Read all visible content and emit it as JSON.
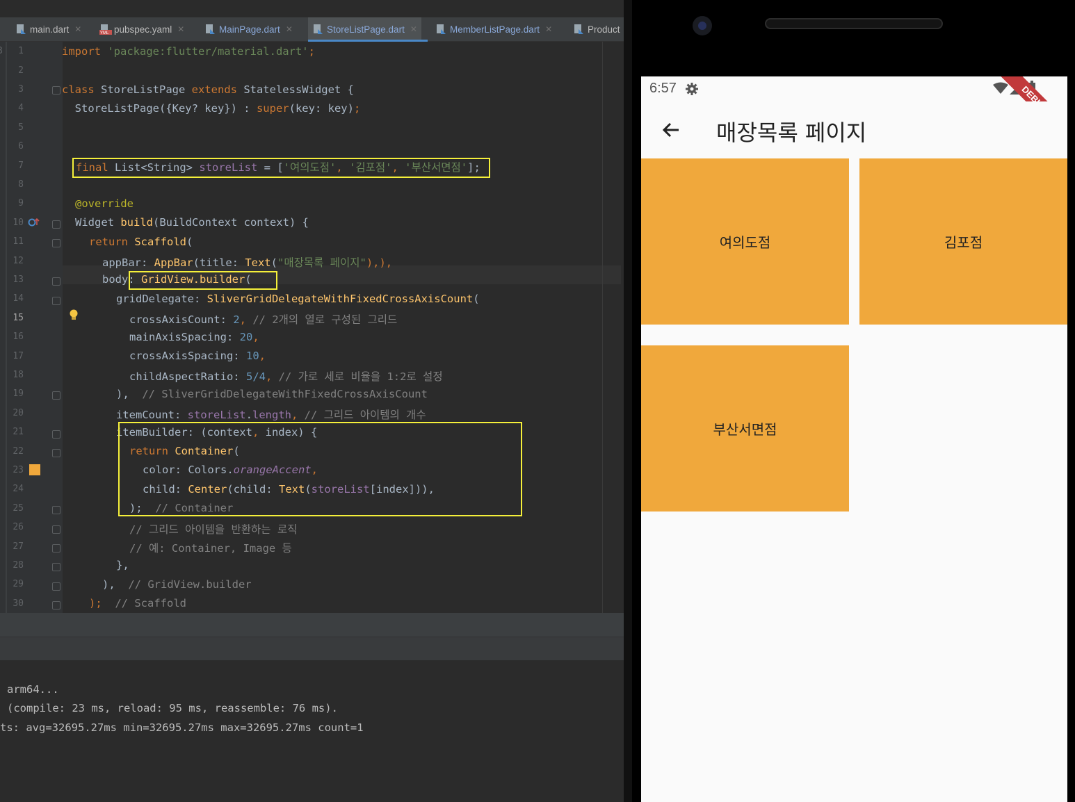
{
  "ide": {
    "tabs": [
      {
        "label": "main.dart",
        "icon": "dart-file-icon"
      },
      {
        "label": "pubspec.yaml",
        "icon": "yaml-file-icon"
      },
      {
        "label": "MainPage.dart",
        "icon": "dart-file-icon"
      },
      {
        "label": "StoreListPage.dart",
        "icon": "dart-file-icon"
      },
      {
        "label": "MemberListPage.dart",
        "icon": "dart-file-icon"
      },
      {
        "label": "Product",
        "icon": "dart-file-icon"
      }
    ],
    "gutter_marker": "3",
    "line_numbers": [
      "1",
      "2",
      "3",
      "4",
      "5",
      "6",
      "7",
      "8",
      "9",
      "10",
      "11",
      "12",
      "13",
      "14",
      "15",
      "16",
      "17",
      "18",
      "19",
      "20",
      "21",
      "22",
      "23",
      "24",
      "25",
      "26",
      "27",
      "28",
      "29",
      "30"
    ],
    "code": {
      "l1_kw": "import",
      "l1_str": " 'package:flutter/material.dart'",
      "l1_end": ";",
      "l3_kw": "class",
      "l3_a": " StoreListPage ",
      "l3_kw2": "extends",
      "l3_b": " StatelessWidget {",
      "l4_a": "  StoreListPage({Key? key}) : ",
      "l4_kw": "super",
      "l4_b": "(key: key)",
      "l4_end": ";",
      "l7_kw": "final",
      "l7_a": " List<String> ",
      "l7_var": "storeList",
      "l7_b": " = [",
      "l7_s1": "'여의도점'",
      "l7_c1": ", ",
      "l7_s2": "'김포점'",
      "l7_c2": ", ",
      "l7_s3": "'부산서면점'",
      "l7_end": "];",
      "l9": "@override",
      "l10_a": "Widget ",
      "l10_fn": "build",
      "l10_b": "(BuildContext context) {",
      "l11_kw": "return",
      "l11_fn": " Scaffold",
      "l11_b": "(",
      "l12_a": "appBar: ",
      "l12_fn": "AppBar",
      "l12_b": "(title: ",
      "l12_fn2": "Text",
      "l12_c": "(",
      "l12_str": "\"매장목록 페이지\"",
      "l12_d": "),),",
      "l13_a": "body",
      "l13_b": ": ",
      "l13_fn": "GridView.builder",
      "l13_c": "(",
      "l14_a": "gridDelegate: ",
      "l14_fn": "SliverGridDelegateWithFixedCrossAxisCount",
      "l14_b": "(",
      "l15_a": "crossAxisCount: ",
      "l15_n": "2",
      "l15_b": ", ",
      "l15_cm": "// 2개의 열로 구성된 그리드",
      "l16_a": "mainAxisSpacing: ",
      "l16_n": "20",
      "l16_b": ",",
      "l17_a": "crossAxisSpacing: ",
      "l17_n": "10",
      "l17_b": ",",
      "l18_a": "childAspectRatio: ",
      "l18_n": "5/4",
      "l18_b": ", ",
      "l18_cm": "// 가로 세로 비율을 1:2로 설정",
      "l19_a": "),",
      "l19_cm": "  // SliverGridDelegateWithFixedCrossAxisCount",
      "l20_a": "itemCount: ",
      "l20_var": "storeList",
      "l20_b": ".",
      "l20_var2": "length",
      "l20_c": ", ",
      "l20_cm": "// 그리드 아이템의 개수",
      "l21_a": "itemBuilder: (context",
      "l21_b": ", ",
      "l21_c": "index) {",
      "l22_kw": "return",
      "l22_fn": " Container",
      "l22_b": "(",
      "l23_a": "color: Colors.",
      "l23_it": "orangeAccent",
      "l23_b": ",",
      "l24_a": "child: ",
      "l24_fn": "Center",
      "l24_b": "(child: ",
      "l24_fn2": "Text",
      "l24_c": "(",
      "l24_var": "storeList",
      "l24_d": "[index])),",
      "l25_a": ");",
      "l25_cm": "  // Container",
      "l26_cm": "// 그리드 아이템을 반환하는 로직",
      "l27_cm": "// 예: Container, Image 등",
      "l28_a": "},",
      "l29_a": "),",
      "l29_cm": "  // GridView.builder",
      "l30_a": ");",
      "l30_cm": "  // Scaffold"
    },
    "console": [
      "arm64...",
      "(compile: 23 ms, reload: 95 ms, reassemble: 76 ms).",
      "ts: avg=32695.27ms min=32695.27ms max=32695.27ms count=1"
    ]
  },
  "phone": {
    "status_time": "6:57",
    "appbar_title": "매장목록 페이지",
    "debug_banner": "DEBUG",
    "grid_items": [
      "여의도점",
      "김포점",
      "부산서면점"
    ],
    "item_color": "#f0a83c"
  }
}
